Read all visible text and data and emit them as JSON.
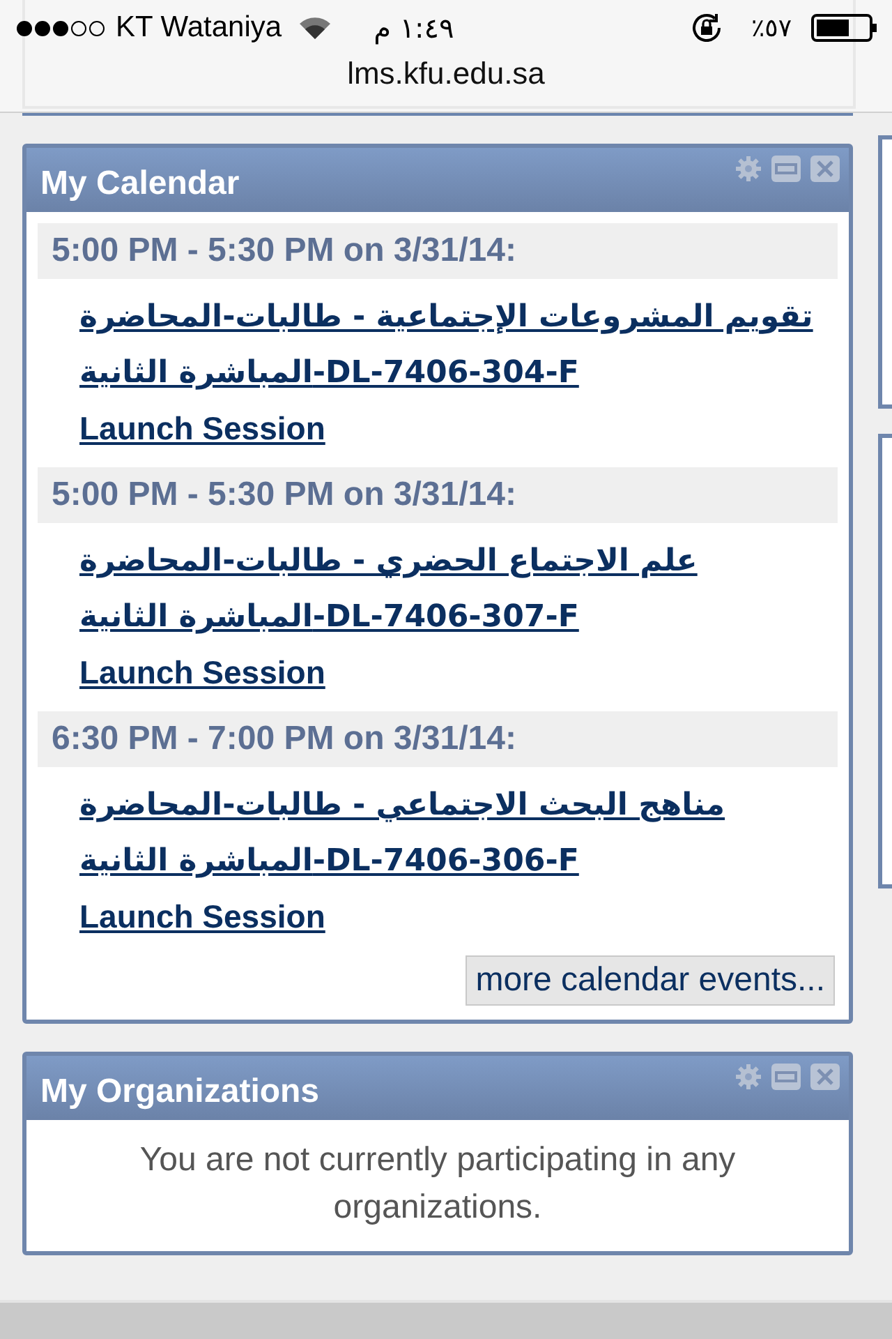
{
  "status_bar": {
    "carrier": "KT Wataniya",
    "time": "١:٤٩ م",
    "battery_text": "٪٥٧"
  },
  "url": "lms.kfu.edu.sa",
  "calendar": {
    "title": "My Calendar",
    "events": [
      {
        "time": "5:00 PM - 5:30 PM on 3/31/14:",
        "title_lines": [
          "تقويم المشروعات الإجتماعية - طالبات-المحاضرة",
          "المباشرة الثانية-DL-7406-304-F"
        ],
        "action": "Launch Session"
      },
      {
        "time": "5:00 PM - 5:30 PM on 3/31/14:",
        "title_lines": [
          "علم الاجتماع الحضري - طالبات-المحاضرة",
          "المباشرة الثانية-DL-7406-307-F"
        ],
        "action": "Launch Session"
      },
      {
        "time": "6:30 PM - 7:00 PM on 3/31/14:",
        "title_lines": [
          "مناهج البحث الاجتماعي - طالبات-المحاضرة",
          "المباشرة الثانية-DL-7406-306-F"
        ],
        "action": "Launch Session"
      }
    ],
    "more_button": "more calendar events..."
  },
  "organizations": {
    "title": "My Organizations",
    "message": "You are not currently participating in any organizations."
  }
}
